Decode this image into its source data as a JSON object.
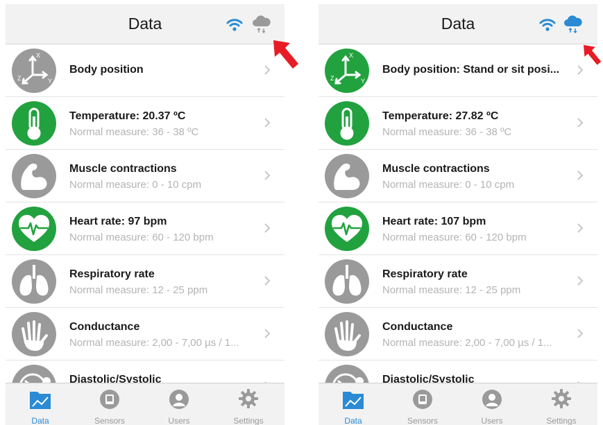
{
  "colors": {
    "green": "#22a23f",
    "gray": "#9a9a9a",
    "blue": "#2a8bd4",
    "red": "#e81c24"
  },
  "screens": [
    {
      "title": "Data",
      "wifi_icon": "wifi-icon",
      "cloud_icon": "cloud-sync-icon",
      "cloud_color": "#9a9a9a",
      "rows": [
        {
          "icon": "axes-icon",
          "status": "gray",
          "title": "Body position",
          "subtitle": ""
        },
        {
          "icon": "thermometer-icon",
          "status": "green",
          "title": "Temperature: 20.37 ºC",
          "subtitle": "Normal measure: 36 - 38 ºC"
        },
        {
          "icon": "muscle-icon",
          "status": "gray",
          "title": "Muscle contractions",
          "subtitle": "Normal measure: 0 - 10 cpm"
        },
        {
          "icon": "heart-icon",
          "status": "green",
          "title": "Heart rate: 97 bpm",
          "subtitle": "Normal measure: 60 - 120 bpm"
        },
        {
          "icon": "lungs-icon",
          "status": "gray",
          "title": "Respiratory rate",
          "subtitle": "Normal measure: 12 - 25 ppm"
        },
        {
          "icon": "hand-icon",
          "status": "gray",
          "title": "Conductance",
          "subtitle": "Normal measure: 2,00 - 7,00 µs / 1..."
        },
        {
          "icon": "gauge-icon",
          "status": "gray",
          "title": "Diastolic/Systolic",
          "subtitle": ""
        }
      ],
      "tabs": [
        {
          "label": "Data",
          "icon": "chart-folder-icon",
          "active": true
        },
        {
          "label": "Sensors",
          "icon": "sensor-icon",
          "active": false
        },
        {
          "label": "Users",
          "icon": "user-icon",
          "active": false
        },
        {
          "label": "Settings",
          "icon": "gear-icon",
          "active": false
        }
      ]
    },
    {
      "title": "Data",
      "wifi_icon": "wifi-icon",
      "cloud_icon": "cloud-sync-icon",
      "cloud_color": "#2a8bd4",
      "rows": [
        {
          "icon": "axes-icon",
          "status": "green",
          "title": "Body position: Stand or sit posi...",
          "subtitle": ""
        },
        {
          "icon": "thermometer-icon",
          "status": "green",
          "title": "Temperature: 27.82 ºC",
          "subtitle": "Normal measure: 36 - 38 ºC"
        },
        {
          "icon": "muscle-icon",
          "status": "gray",
          "title": "Muscle contractions",
          "subtitle": "Normal measure: 0 - 10 cpm"
        },
        {
          "icon": "heart-icon",
          "status": "green",
          "title": "Heart rate: 107 bpm",
          "subtitle": "Normal measure: 60 - 120 bpm"
        },
        {
          "icon": "lungs-icon",
          "status": "gray",
          "title": "Respiratory rate",
          "subtitle": "Normal measure: 12 - 25 ppm"
        },
        {
          "icon": "hand-icon",
          "status": "gray",
          "title": "Conductance",
          "subtitle": "Normal measure: 2,00 - 7,00 µs / 1..."
        },
        {
          "icon": "gauge-icon",
          "status": "gray",
          "title": "Diastolic/Systolic",
          "subtitle": ""
        }
      ],
      "tabs": [
        {
          "label": "Data",
          "icon": "chart-folder-icon",
          "active": true
        },
        {
          "label": "Sensors",
          "icon": "sensor-icon",
          "active": false
        },
        {
          "label": "Users",
          "icon": "user-icon",
          "active": false
        },
        {
          "label": "Settings",
          "icon": "gear-icon",
          "active": false
        }
      ]
    }
  ]
}
